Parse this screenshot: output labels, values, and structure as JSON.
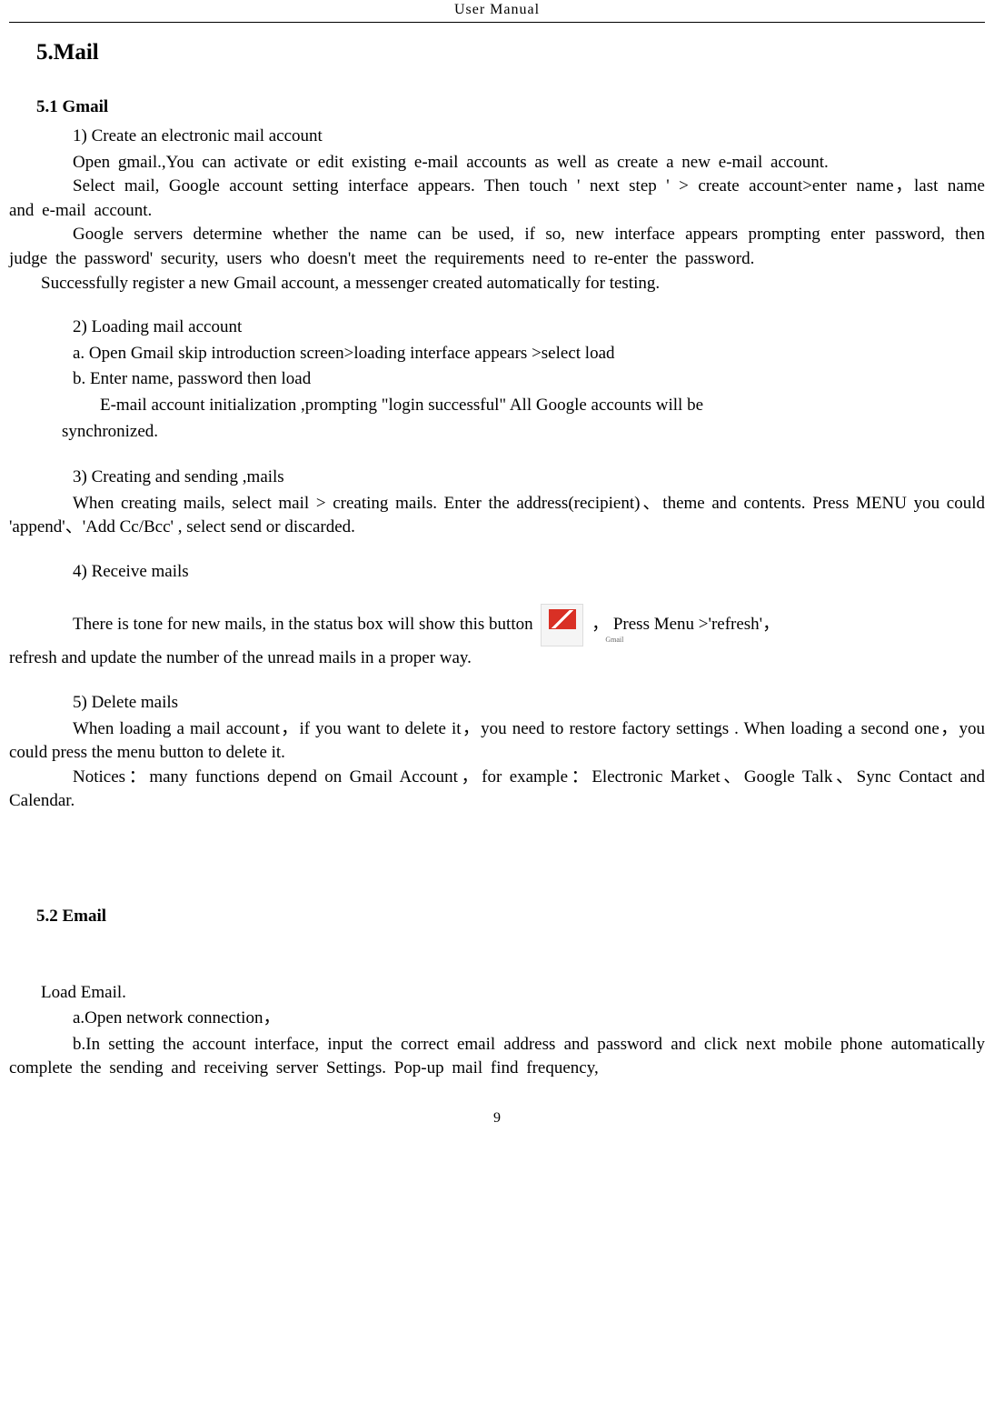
{
  "header": "User    Manual",
  "section_title": "5.Mail",
  "sub_5_1": "5.1 Gmail",
  "p1": "1) Create an electronic mail account",
  "p2": "Open gmail.,You can activate or edit existing e-mail accounts as well as create a new e-mail account.",
  "p3": "Select mail, Google account setting interface appears. Then touch ' next step ' > create account>enter name，last name and e-mail account.",
  "p4": "Google servers determine whether the name can be used, if so, new interface appears prompting enter password, then judge the password' security, users who doesn't meet the requirements need to re-enter the password.",
  "p5": "Successfully register a new Gmail account, a messenger created automatically for testing.",
  "p6": "2) Loading mail account",
  "p7": "a. Open Gmail skip introduction screen>loading interface appears >select load",
  "p8": "b. Enter name, password then load",
  "p9": "E-mail account initialization ,prompting \"login successful\" All Google accounts will be",
  "p9b": "synchronized.",
  "p10": "3) Creating and sending ,mails",
  "p11": "When creating mails, select mail > creating mails. Enter the address(recipient)、theme and contents. Press MENU you could  'append'、'Add Cc/Bcc' ,    select send or discarded.",
  "p12": "4) Receive mails",
  "p13_a": "There is tone for new mails, in the status box will show this button ",
  "p13_b": "， Press Menu >'refresh'，",
  "p14": "refresh and update the number of the unread mails in a proper way.",
  "p15": "5) Delete    mails",
  "p16": "When loading a mail account，if you want to delete it，you need to restore factory settings . When loading a second one，you could press the menu button to delete it.",
  "p17": "Notices：many functions depend on Gmail Account，for example：Electronic Market、Google Talk、Sync Contact and Calendar.",
  "sub_5_2": "5.2 Email",
  "p18": "Load Email.",
  "p19": "a.Open network connection，",
  "p20": "b.In setting the account interface, input the correct email address and password and click next mobile phone automatically complete the sending and receiving server Settings. Pop-up mail find frequency,",
  "icon_label": "Gmail",
  "page_number": "9"
}
